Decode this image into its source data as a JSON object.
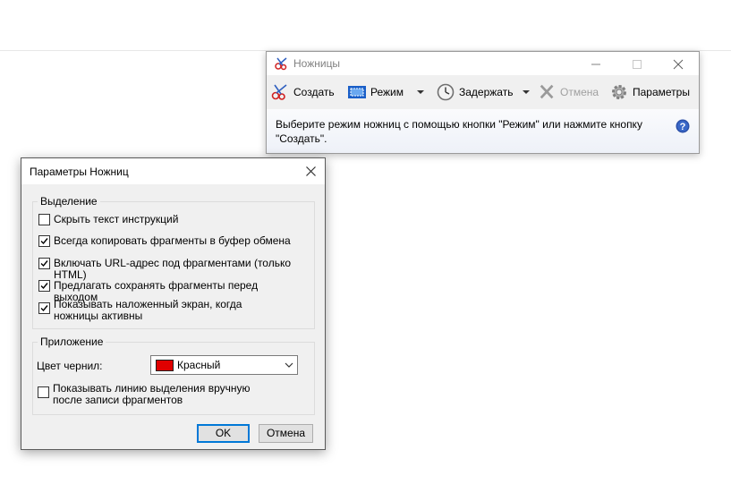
{
  "snip": {
    "title": "Ножницы",
    "toolbar": {
      "new_label": "Создать",
      "mode_label": "Режим",
      "delay_label": "Задержать",
      "cancel_label": "Отмена",
      "options_label": "Параметры"
    },
    "info_text": "Выберите режим ножниц с помощью кнопки \"Режим\" или нажмите кнопку \"Создать\"."
  },
  "options": {
    "title": "Параметры Ножниц",
    "selection_group": {
      "label": "Выделение",
      "items": [
        {
          "label": "Скрыть текст инструкций",
          "checked": false
        },
        {
          "label": "Всегда копировать фрагменты в буфер обмена",
          "checked": true
        },
        {
          "label": "Включать URL-адрес под фрагментами (только HTML)",
          "checked": true
        },
        {
          "label": "Предлагать сохранять фрагменты перед выходом",
          "checked": true
        },
        {
          "label": "Показывать наложенный экран, когда ножницы активны",
          "checked": true
        }
      ]
    },
    "app_group": {
      "label": "Приложение",
      "ink_label": "Цвет чернил:",
      "ink_value": "Красный",
      "ink_color": "#e00000",
      "show_line": {
        "label": "Показывать линию выделения вручную после записи фрагментов",
        "checked": false
      }
    },
    "ok_label": "OK",
    "cancel_label": "Отмена"
  }
}
